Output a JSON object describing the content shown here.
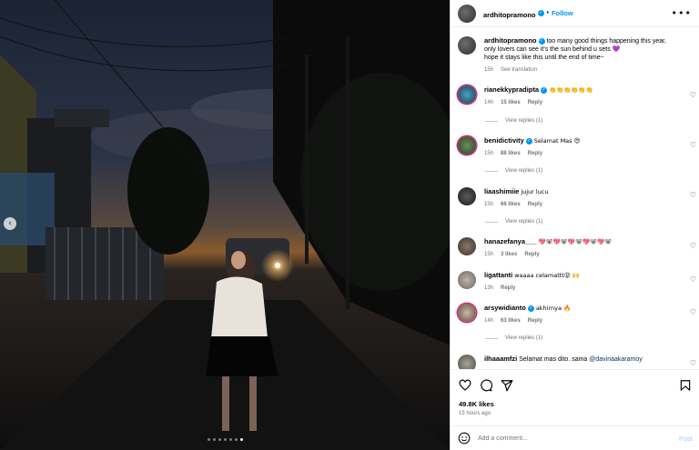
{
  "post": {
    "author": "ardhitopramono",
    "follow_label": "Follow",
    "follow_separator": "•",
    "more_icon": "more-horizontal-icon",
    "caption_user": "ardhitopramono",
    "caption_line1": "too many good things happening this year,",
    "caption_line2": "only lovers can see it's the sun behind u sets 💜",
    "caption_line3": "hope it stays like this until the end of time~",
    "caption_time": "15h",
    "see_translation": "See translation"
  },
  "comments": [
    {
      "user": "rianekkypradipta",
      "verified": true,
      "text": "👏👏👏👏👏👏",
      "time": "14h",
      "likes": "15 likes",
      "reply": "Reply",
      "replies": "View replies (1)"
    },
    {
      "user": "benidictivity",
      "verified": true,
      "text": "Selamat Mas 😍",
      "time": "15h",
      "likes": "88 likes",
      "reply": "Reply",
      "replies": "View replies (1)"
    },
    {
      "user": "liaashimiie",
      "verified": false,
      "text": "jujur lucu",
      "time": "15h",
      "likes": "66 likes",
      "reply": "Reply",
      "replies": "View replies (1)"
    },
    {
      "user": "hanazefanya___",
      "verified": false,
      "text": "💖🐨💖🐨💖🐨💖🐨💖🐨",
      "time": "15h",
      "likes": "3 likes",
      "reply": "Reply"
    },
    {
      "user": "ligattanti",
      "verified": false,
      "text": "waaaa celamattt😝 🙌",
      "time": "13h",
      "reply": "Reply"
    },
    {
      "user": "arsywidianto",
      "verified": true,
      "text": "akhirnya 🔥",
      "time": "14h",
      "likes": "63 likes",
      "reply": "Reply",
      "replies": "View replies (1)"
    },
    {
      "user": "ilhaaamfzi",
      "verified": false,
      "text": "Selamat mas dito. sama ",
      "mention": "@davinaakaramoy"
    }
  ],
  "footer": {
    "likes": "49.8K likes",
    "time_ago": "15 hours ago",
    "comment_placeholder": "Add a comment...",
    "post_label": "Post"
  },
  "carousel": {
    "total": 7,
    "active": 6
  },
  "colors": {
    "accent": "#0095f6",
    "verified": "#0095f6",
    "muted": "#737373"
  }
}
